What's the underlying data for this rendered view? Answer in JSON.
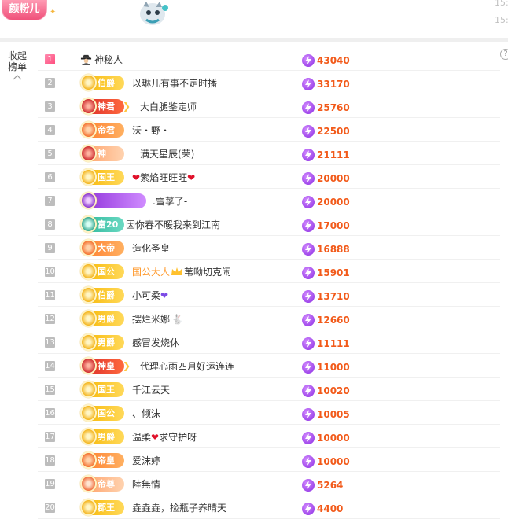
{
  "header": {
    "fan_badge": "颜粉儿",
    "timestamps": [
      "15:",
      "15:"
    ]
  },
  "side": {
    "toggle_label_1": "收起",
    "toggle_label_2": "榜单",
    "help": "?"
  },
  "colors": {
    "score": "#f25a1a",
    "accent_pink": "#ff4d7d"
  },
  "ranking": [
    {
      "rank": "1",
      "badge": "",
      "badge_style": "none",
      "name_prefix": "",
      "name": "神秘人",
      "score": "43040",
      "icon": "spy-icon"
    },
    {
      "rank": "2",
      "badge": "伯爵",
      "badge_style": "yellow",
      "name": "以琳儿有事不定时播",
      "score": "33170"
    },
    {
      "rank": "3",
      "badge": "神君",
      "badge_style": "red",
      "name": "大白腿鉴定师",
      "score": "25760"
    },
    {
      "rank": "4",
      "badge": "帝君",
      "badge_style": "orange",
      "name": "沃・野・",
      "score": "22500"
    },
    {
      "rank": "5",
      "badge": "神",
      "badge_style": "peach",
      "name": "满天星辰(荣)",
      "score": "21111"
    },
    {
      "rank": "6",
      "badge": "国王",
      "badge_style": "yellow",
      "name": "紫焰旺旺旺",
      "score": "20000"
    },
    {
      "rank": "7",
      "badge": "",
      "badge_style": "purple",
      "name": ".雪莩了-",
      "score": "20000"
    },
    {
      "rank": "8",
      "badge": "富20",
      "badge_style": "teal",
      "name": "因你春不暖我来到江南",
      "score": "17000"
    },
    {
      "rank": "9",
      "badge": "大帝",
      "badge_style": "orange",
      "name": "造化圣皇",
      "score": "16888"
    },
    {
      "rank": "10",
      "badge": "国公",
      "badge_style": "yellow",
      "name_prefix": "国公大人",
      "name": "苇呦切克闹",
      "score": "15901"
    },
    {
      "rank": "11",
      "badge": "伯爵",
      "badge_style": "yellow",
      "name": "小可柔",
      "score": "13710"
    },
    {
      "rank": "12",
      "badge": "男爵",
      "badge_style": "yellow",
      "name": "摆烂米娜",
      "score": "12660"
    },
    {
      "rank": "13",
      "badge": "男爵",
      "badge_style": "yellow",
      "name": "感冒发烧休",
      "score": "11111"
    },
    {
      "rank": "14",
      "badge": "神皇",
      "badge_style": "red",
      "name": "代理心雨四月好运连连",
      "score": "11000"
    },
    {
      "rank": "15",
      "badge": "国王",
      "badge_style": "yellow",
      "name": "千江云天",
      "score": "10020"
    },
    {
      "rank": "16",
      "badge": "国公",
      "badge_style": "yellow",
      "name": "、倾沫",
      "score": "10005"
    },
    {
      "rank": "17",
      "badge": "男爵",
      "badge_style": "yellow",
      "name_a": "温柔",
      "name_b": "求守护呀",
      "score": "10000"
    },
    {
      "rank": "18",
      "badge": "帝皇",
      "badge_style": "orange",
      "name": "爱沫婷",
      "score": "10000"
    },
    {
      "rank": "19",
      "badge": "帝尊",
      "badge_style": "peach",
      "name": "陸無情",
      "score": "5264"
    },
    {
      "rank": "20",
      "badge": "郡王",
      "badge_style": "yellow",
      "name": "垚垚垚，捡瓶子养晴天",
      "score": "4400"
    }
  ]
}
